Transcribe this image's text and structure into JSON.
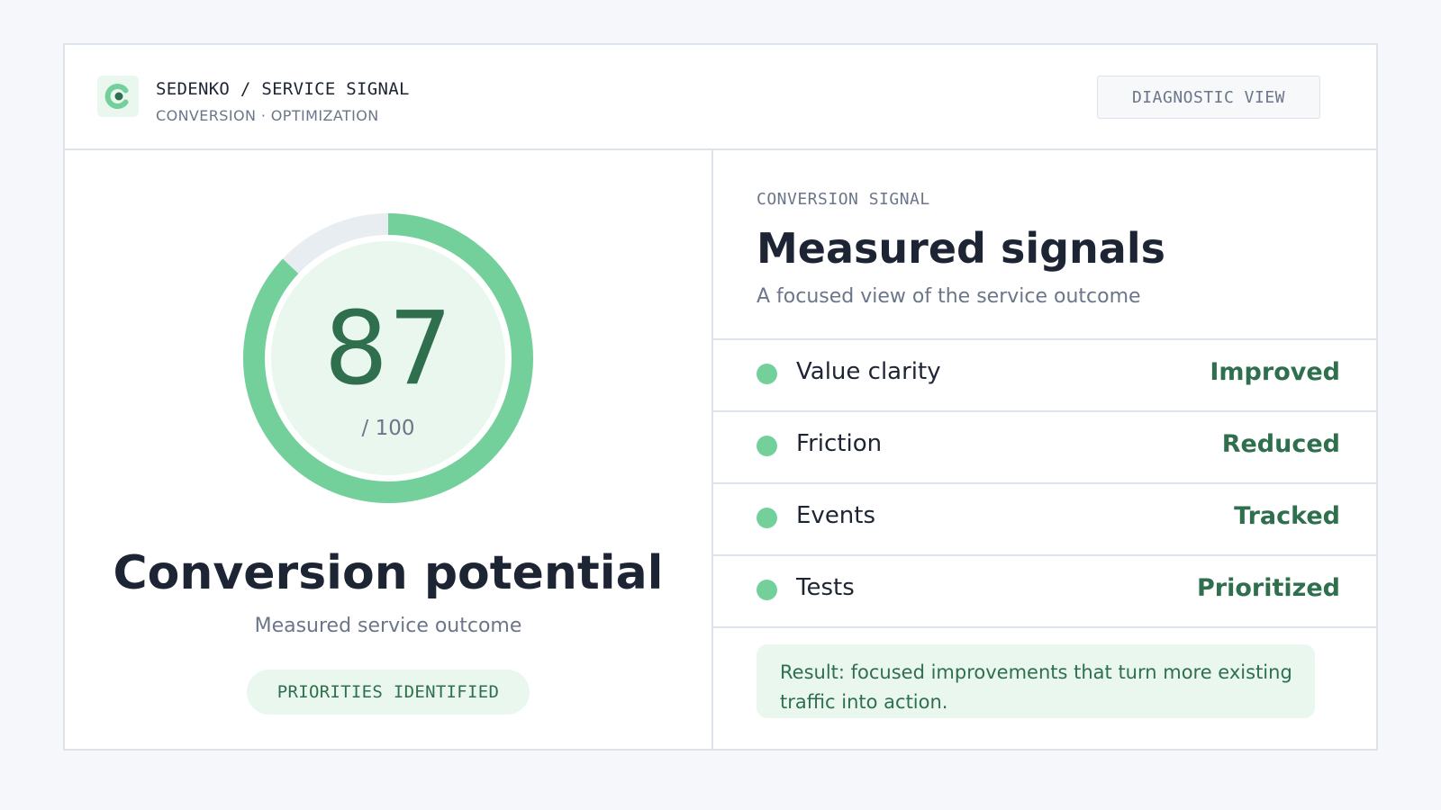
{
  "header": {
    "brand_title": "SEDENKO / SERVICE SIGNAL",
    "brand_subtitle": "CONVERSION · OPTIMIZATION",
    "diagnostic_button": "DIAGNOSTIC VIEW",
    "logo_icon": "c-logo-icon"
  },
  "score": {
    "value": "87",
    "max_label": "/ 100",
    "fraction": 0.87,
    "title": "Conversion potential",
    "subtitle": "Measured service outcome",
    "badge": "PRIORITIES IDENTIFIED"
  },
  "signals": {
    "eyebrow": "CONVERSION SIGNAL",
    "title": "Measured signals",
    "subtitle": "A focused view of the service outcome",
    "rows": [
      {
        "label": "Value clarity",
        "status": "Improved"
      },
      {
        "label": "Friction",
        "status": "Reduced"
      },
      {
        "label": "Events",
        "status": "Tracked"
      },
      {
        "label": "Tests",
        "status": "Prioritized"
      }
    ],
    "result": "Result: focused improvements that turn more existing traffic into action."
  },
  "colors": {
    "accent": "#74d09b",
    "accent_dark": "#2f6f4e",
    "accent_light": "#e9f7ef",
    "track": "#e8edf2",
    "text": "#1d2433",
    "muted": "#6b7689",
    "border": "#dde3ea"
  }
}
